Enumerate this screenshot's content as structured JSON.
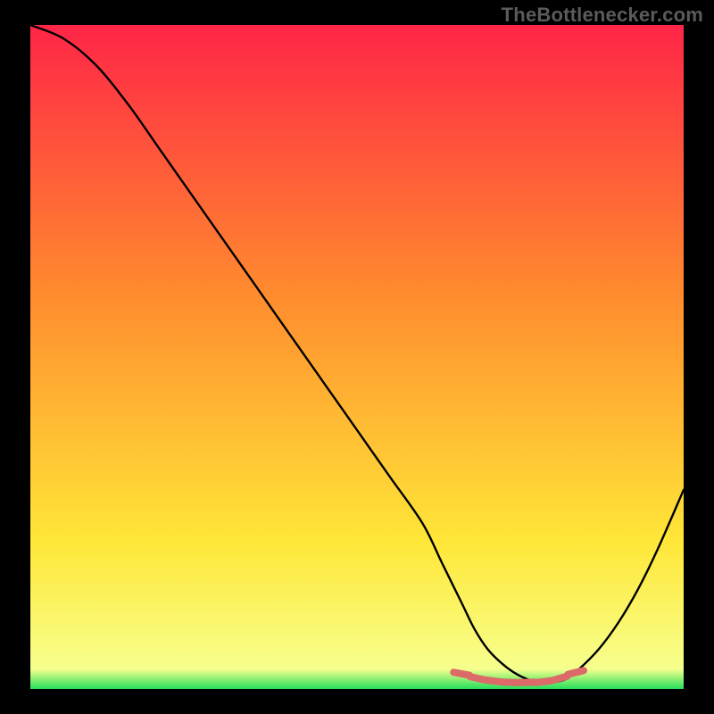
{
  "attribution": "TheBottlenecker.com",
  "chart_data": {
    "type": "line",
    "title": "",
    "xlabel": "",
    "ylabel": "",
    "xlim": [
      0,
      100
    ],
    "ylim": [
      0,
      100
    ],
    "background_gradient": {
      "top": "#ff2547",
      "mid_upper": "#ff8a2e",
      "mid_lower": "#ffe738",
      "bottom": "#24e05a"
    },
    "series": [
      {
        "name": "bottleneck-curve",
        "stroke": "#000000",
        "x": [
          0,
          5,
          10,
          15,
          20,
          25,
          30,
          35,
          40,
          45,
          50,
          55,
          60,
          63,
          66,
          68,
          70,
          72,
          74,
          76,
          78,
          80,
          82,
          84,
          87,
          90,
          93,
          96,
          100
        ],
        "values": [
          100,
          98,
          94,
          88,
          81,
          74,
          67,
          60,
          53,
          46,
          39,
          32,
          25,
          19,
          13,
          9,
          6,
          4,
          2.5,
          1.5,
          1,
          1,
          1.5,
          3,
          6,
          10,
          15,
          21,
          30
        ]
      }
    ],
    "marker_cluster": {
      "stroke": "#db6a68",
      "x": [
        66,
        68.5,
        71,
        73.5,
        76,
        78.5,
        81,
        83.5
      ],
      "values": [
        2.3,
        1.6,
        1.2,
        1.0,
        1.0,
        1.1,
        1.6,
        2.5
      ]
    }
  }
}
